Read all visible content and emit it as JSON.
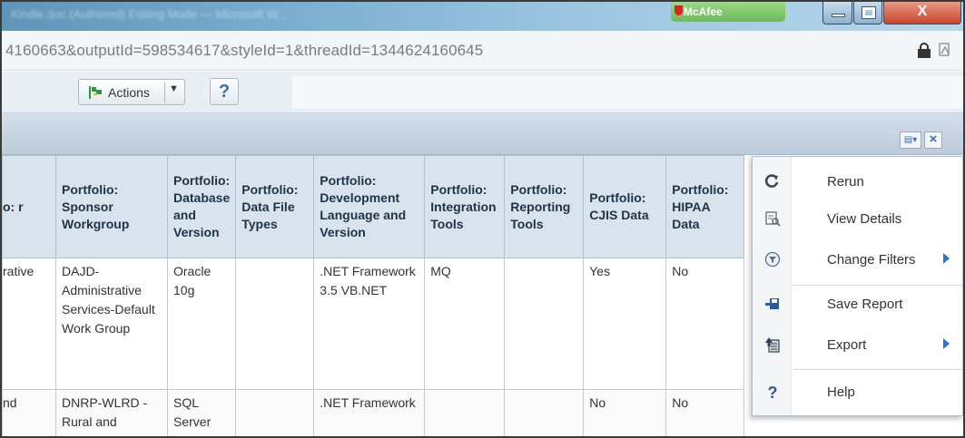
{
  "window": {
    "title": "Kindle.doc (Authored) Editing Mode — Microsoft W...",
    "mcafee_label": "McAfee",
    "close_glyph": "X"
  },
  "address_bar": {
    "url": "4160663&outputId=598534617&styleId=1&threadId=1344624160645"
  },
  "toolbar": {
    "actions_label": "Actions",
    "help_label": "?"
  },
  "report_header": {
    "close_glyph": "×"
  },
  "table": {
    "headers": [
      "o: r",
      "Portfolio: Sponsor Workgroup",
      "Portfolio: Database and Version",
      "Portfolio: Data File Types",
      "Portfolio: Development Language and Version",
      "Portfolio: Integration Tools",
      "Portfolio: Reporting Tools",
      "Portfolio: CJIS Data",
      "Portfolio: HIPAA Data"
    ],
    "rows": [
      [
        "rative",
        "DAJD-Administrative Services-Default Work Group",
        "Oracle 10g",
        "",
        ".NET Framework 3.5 VB.NET",
        "MQ",
        "",
        "Yes",
        "No"
      ],
      [
        "nd",
        "DNRP-WLRD -Rural and",
        "SQL Server",
        "",
        ".NET Framework",
        "",
        "",
        "No",
        "No"
      ]
    ]
  },
  "context_menu": {
    "items": [
      {
        "label": "Rerun",
        "icon": "refresh-icon"
      },
      {
        "label": "View Details",
        "icon": "view-details-icon"
      },
      {
        "label": "Change Filters",
        "icon": "filter-icon",
        "has_submenu": true
      },
      {
        "label": "Save Report",
        "icon": "save-icon"
      },
      {
        "label": "Export",
        "icon": "export-icon",
        "has_submenu": true
      },
      {
        "label": "Help",
        "icon": "help-icon"
      }
    ]
  },
  "colors": {
    "accent": "#2f76c7",
    "header_bg": "#d8e3ee",
    "flag_green": "#2e9b3a"
  }
}
